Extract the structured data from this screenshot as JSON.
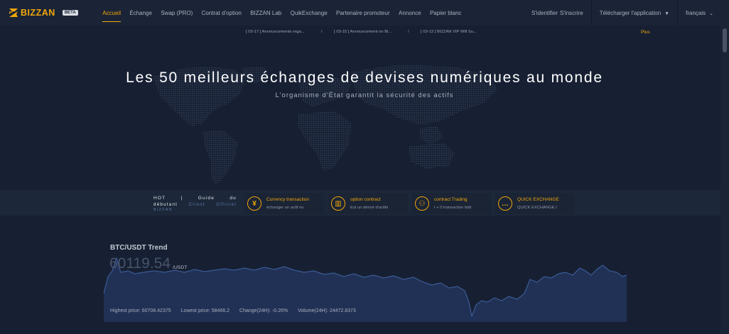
{
  "brand": {
    "name": "BIZZAN",
    "badge": "BETA",
    "color": "#f0a70a"
  },
  "nav": {
    "items": [
      {
        "label": "Accueil",
        "active": true
      },
      {
        "label": "Échange"
      },
      {
        "label": "Swap (PRO)"
      },
      {
        "label": "Contrat d'option"
      },
      {
        "label": "BIZZAN Lab"
      },
      {
        "label": "QuikExchange"
      },
      {
        "label": "Partenaire promoteur"
      },
      {
        "label": "Annonce"
      },
      {
        "label": "Papier blanc"
      }
    ],
    "login": "S'identifier",
    "register": "S'inscrire",
    "download": "Télécharger l'application",
    "language": "français"
  },
  "announcements": {
    "items": [
      "[ 03-17 ] Announcements rega...",
      "[ 03-15 ] Announcement on Bl...",
      "[ 03-12 ] BIZZAN VIP Will Su..."
    ],
    "separator": "/",
    "more": "Plus"
  },
  "hero": {
    "title": "Les 50 meilleurs échanges de devises numériques au monde",
    "subtitle": "L'organisme d'État garantit la sécurité des actifs"
  },
  "hot": {
    "line1": [
      "HOT",
      "|",
      "Guide",
      "du"
    ],
    "line2_left": "débutant",
    "line2_items": [
      "Client",
      "Officiel"
    ],
    "line3": "BIZZAN"
  },
  "features": [
    {
      "icon": "yen-icon",
      "glyph": "¥",
      "title": "Currency transaction",
      "desc": "échanger un actif nu"
    },
    {
      "icon": "chart-icon",
      "glyph": "▥",
      "title": "option contract",
      "desc": "Est un dérivé d'actifs"
    },
    {
      "icon": "network-icon",
      "glyph": "⚇",
      "title": "contract Trading",
      "desc": "t + 0 transaction bidi"
    },
    {
      "icon": "chat-icon",
      "glyph": "…",
      "title": "QUICK EXCHANGE",
      "desc": "QUICK EXCHANGE I"
    }
  ],
  "trend": {
    "title": "BTC/USDT Trend",
    "price": "60119.54",
    "unit": "/USDT",
    "stats": {
      "high": "Highest price: 60708.42375",
      "low": "Lowest price: 58466.2",
      "change": "Change(24H): -0.26%",
      "volume": "Volume(24H): 24472.8373"
    },
    "line_color": "#3a5b94",
    "fill_color": "#22335a"
  }
}
